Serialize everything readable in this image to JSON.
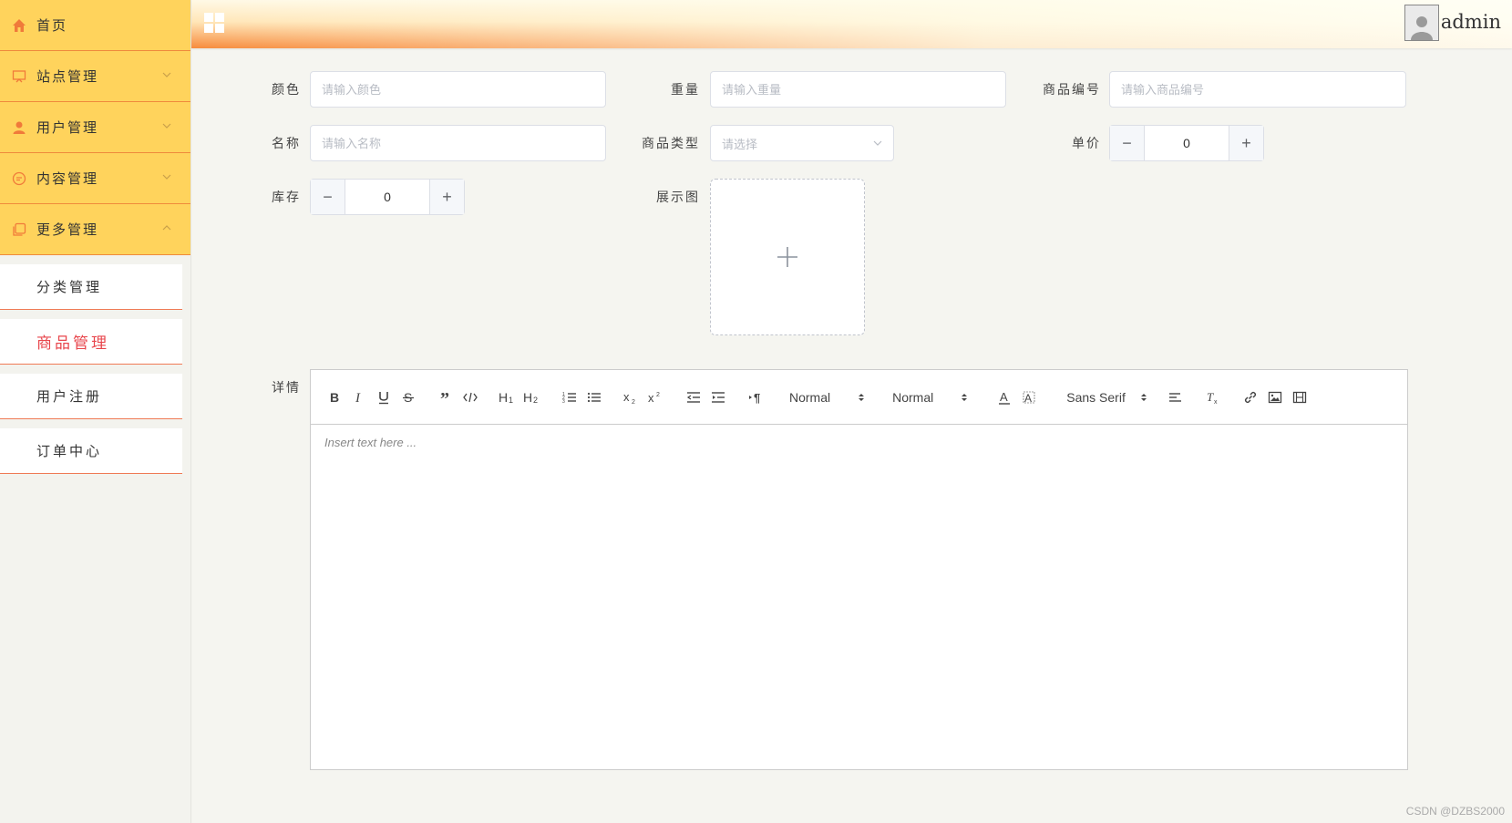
{
  "sidebar": {
    "items": [
      {
        "label": "首页",
        "icon": "home-icon"
      },
      {
        "label": "站点管理",
        "icon": "monitor-icon"
      },
      {
        "label": "用户管理",
        "icon": "user-icon"
      },
      {
        "label": "内容管理",
        "icon": "chat-icon"
      },
      {
        "label": "更多管理",
        "icon": "copy-icon"
      }
    ],
    "submenu": [
      {
        "label": "分类管理"
      },
      {
        "label": "商品管理",
        "active": true
      },
      {
        "label": "用户注册"
      },
      {
        "label": "订单中心"
      }
    ]
  },
  "header": {
    "menu_icon": "grid-icon",
    "username": "admin"
  },
  "form": {
    "color": {
      "label": "颜色",
      "placeholder": "请输入颜色"
    },
    "weight": {
      "label": "重量",
      "placeholder": "请输入重量"
    },
    "code": {
      "label": "商品编号",
      "placeholder": "请输入商品编号"
    },
    "name": {
      "label": "名称",
      "placeholder": "请输入名称"
    },
    "type": {
      "label": "商品类型",
      "placeholder": "请选择"
    },
    "price": {
      "label": "单价",
      "value": "0"
    },
    "stock": {
      "label": "库存",
      "value": "0"
    },
    "image": {
      "label": "展示图"
    },
    "detail": {
      "label": "详情"
    }
  },
  "editor": {
    "header_picker": "Normal",
    "size_picker": "Normal",
    "font_picker": "Sans Serif",
    "placeholder": "Insert text here ..."
  },
  "watermark": "CSDN @DZBS2000",
  "colors": {
    "menu_bg": "#ffd35c",
    "menu_border": "#ef8a3c",
    "active_text": "#e8464c",
    "icon_orange": "#f07a3a"
  }
}
